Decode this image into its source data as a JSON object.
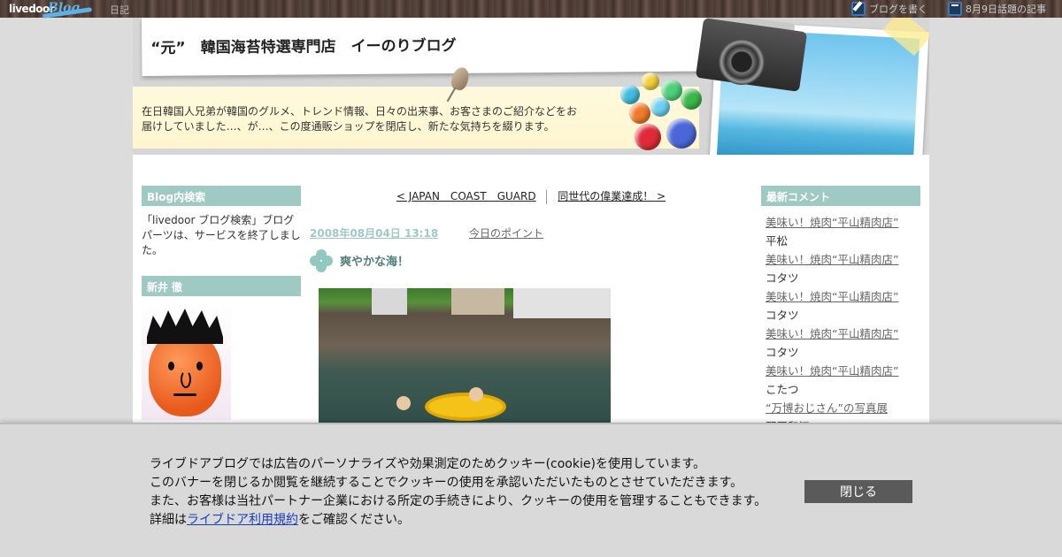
{
  "topbar": {
    "logo_text": "livedoor",
    "logo_blog": "Blog",
    "diary": "日記",
    "write_blog": "ブログを書く",
    "trending": "8月9日話題の記事"
  },
  "header": {
    "title": "“元”　韓国海苔特選専門店　イーのりブログ",
    "description": "在日韓国人兄弟が韓国のグルメ、トレンド情報、日々の出来事、お客さまのご紹介などをお届けしていました…、が…、この度通販ショップを閉店し、新たな気持ちを綴ります。"
  },
  "left": {
    "search_title": "Blog内検索",
    "search_text": "「livedoor ブログ検索」ブログパーツは、サービスを終了しました。",
    "profile_title": "新井 徹"
  },
  "center": {
    "prev_link": "< JAPAN　COAST　GUARD",
    "next_link": "同世代の偉業達成！ >",
    "date": "2008年08月04日 13:18",
    "category": "今日のポイント",
    "entry_title": "爽やかな海！"
  },
  "right": {
    "title": "最新コメント",
    "comments": [
      {
        "link": "美味い！焼肉“平山精肉店”",
        "author": "平松"
      },
      {
        "link": "美味い！焼肉“平山精肉店”",
        "author": "コタツ"
      },
      {
        "link": "美味い！焼肉“平山精肉店”",
        "author": "コタツ"
      },
      {
        "link": "美味い！焼肉“平山精肉店”",
        "author": "コタツ"
      },
      {
        "link": "美味い！焼肉“平山精肉店”",
        "author": "こたつ"
      },
      {
        "link": "“万博おじさん”の写真展",
        "author": "野田和江"
      }
    ]
  },
  "cookie": {
    "line1": "ライブドアブログでは広告のパーソナライズや効果測定のためクッキー(cookie)を使用しています。",
    "line2": "このバナーを閉じるか閲覧を継続することでクッキーの使用を承認いただいたものとさせていただきます。",
    "line3": "また、お客様は当社パートナー企業における所定の手続きにより、クッキーの使用を管理することもできます。",
    "line4_prefix": "詳細は",
    "line4_link": "ライブドア利用規約",
    "line4_suffix": "をご確認ください。",
    "close_label": "閉じる"
  },
  "colors": {
    "accent": "#9fc9c3",
    "entry_title": "#4d7f78",
    "close_button": "#5a5a5a"
  }
}
